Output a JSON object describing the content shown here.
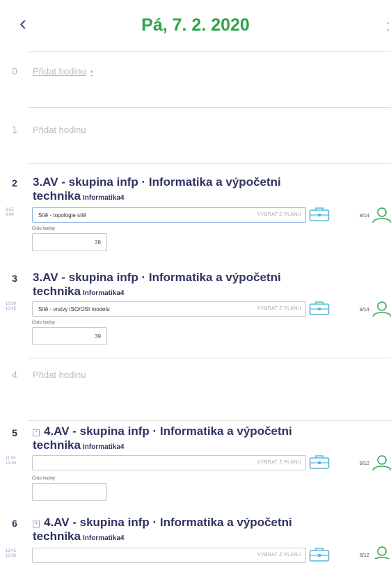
{
  "header": {
    "back_glyph": "‹",
    "date": "Pá, 7. 2. 2020",
    "next_glyph": ":"
  },
  "lessons": [
    {
      "number": "0",
      "add_label": "Přidat hodinu",
      "dot": "•"
    },
    {
      "number": "1",
      "add_label": "Přidat hodinu"
    },
    {
      "number": "2",
      "title": "3.AV - skupina infp · Informatika a výpočetni technika",
      "subject": "Informatika4",
      "time": [
        "8:55",
        "9:40"
      ],
      "topic": "Sítě - topologie sítě",
      "pick_label": "VYBRAT Z PLÁNU",
      "stat": "8/14",
      "lesson_number_label": "Číslo hodiny",
      "lesson_number": "38"
    },
    {
      "number": "3",
      "title": "3.AV - skupina infp · Informatika a výpočetni technika",
      "subject": "Informatika4",
      "time": [
        "10:00",
        "10:45"
      ],
      "topic": "Sítě - vrstvy ISO/OSI modelu",
      "pick_label": "VYBRAT Z PLÁNU",
      "stat": "8/14",
      "lesson_number_label": "Číslo hodiny",
      "lesson_number": "39"
    },
    {
      "number": "4",
      "add_label": "Přidat hodinu"
    },
    {
      "number": "5",
      "title": "4.AV - skupina infp · Informatika a výpočetni technika",
      "subject": "Informatika4",
      "time": [
        "11:50",
        "12:35"
      ],
      "topic": "",
      "pick_label": "VYBRAT Z PLÁNU",
      "stat": "8/12",
      "lesson_number_label": "Číslo hodiny",
      "lesson_number": ""
    },
    {
      "number": "6",
      "title": "4.AV - skupina infp · Informatika a výpočetni technika",
      "subject": "Informatika4",
      "time": [
        "12:45",
        "13:30"
      ],
      "topic": "",
      "pick_label": "VYBRAT Z PLÁNU",
      "stat": "8/12"
    }
  ],
  "colors": {
    "accent_green": "#2fa34a",
    "navy": "#2e3361",
    "muted": "#bcbcbc"
  },
  "icons": [
    "back-chevron-icon",
    "briefcase-icon",
    "person-icon",
    "group-expand-icon"
  ]
}
